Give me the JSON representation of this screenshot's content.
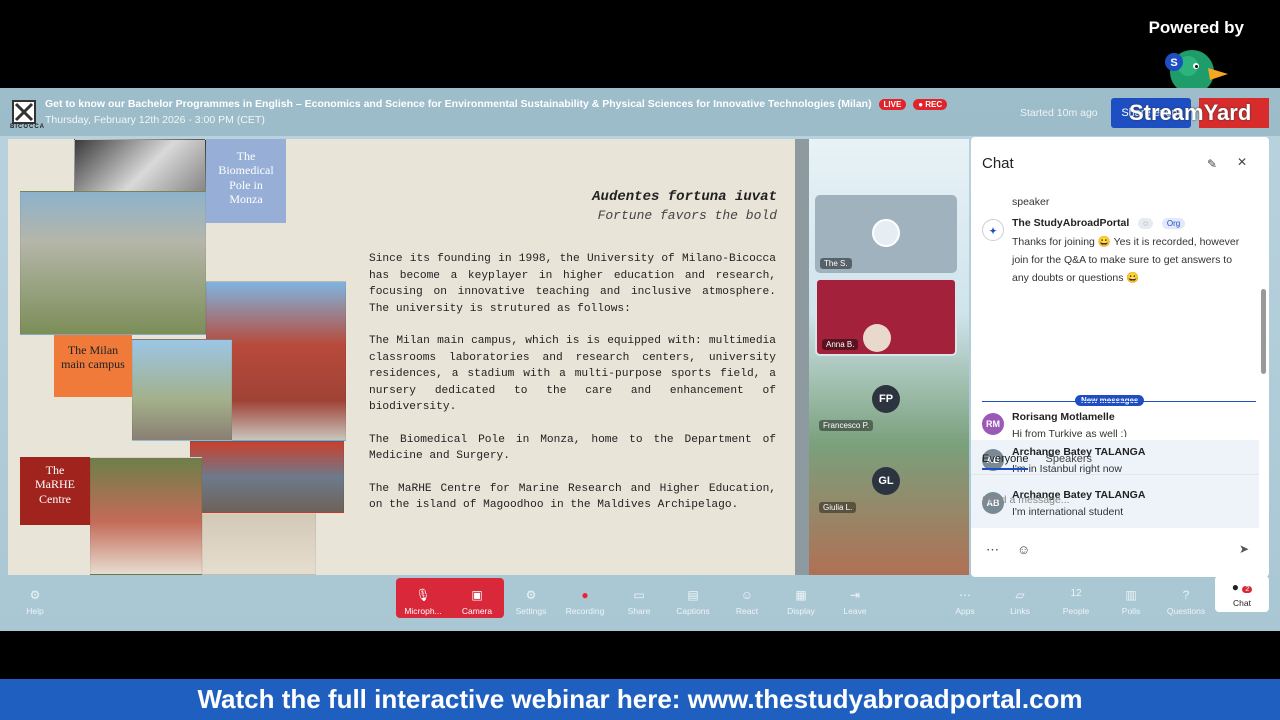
{
  "powered_by": "Powered by",
  "header": {
    "title": "Get to know our Bachelor Programmes in English – Economics and Science for Environmental Sustainability & Physical Sciences for Innovative Technologies (Milan)",
    "subtitle": "Thursday, February 12th 2026 - 3:00 PM (CET)",
    "live_badge": "LIVE",
    "rec_badge": "REC",
    "started": "Started 10m ago",
    "share_label": "Share event",
    "streamyard_text": "StreamYard"
  },
  "slide": {
    "motto_latin": "Audentes fortuna iuvat",
    "motto_english": "Fortune favors the bold",
    "paragraphs": [
      "Since its founding in 1998, the University of Milano-Bicocca has become a keyplayer in higher education and research, focusing on innovative teaching and inclusive atmosphere. The university is strutured as follows:",
      "The Milan main campus, which is is equipped with: multimedia classrooms laboratories and research centers, university residences, a stadium with a multi-purpose sports field, a nursery dedicated to the care and enhancement of biodiversity.",
      "The Biomedical Pole in Monza, home to the Department of Medicine and Surgery.",
      "The MaRHE Centre for Marine Research and Higher Education, on the island of Magoodhoo in the Maldives Archipelago."
    ],
    "note_biomedical": "The Biomedical Pole in Monza",
    "note_milan": "The Milan main campus",
    "note_marhe": "The MaRHE Centre"
  },
  "participants": {
    "tile1_label": "The S.",
    "tile2_label": "Anna B.",
    "fp_initials": "FP",
    "fp_label": "Francesco P.",
    "gl_initials": "GL",
    "gl_label": "Giulia L."
  },
  "chat": {
    "title": "Chat",
    "messages": [
      {
        "name": "",
        "text": "speaker"
      },
      {
        "name": "The StudyAbroadPortal",
        "tag": "Org",
        "text": "Thanks for joining 😀 Yes it is recorded, however join for the Q&A to make sure to get answers to any doubts or questions 😀"
      },
      {
        "initials": "RM",
        "name": "Rorisang Motlamelle",
        "text": "Hi from Turkiye as well :)"
      },
      {
        "initials": "AB",
        "name": "Archange Batey TALANGA",
        "text": "I'm in Istanbul right now"
      },
      {
        "initials": "AB",
        "name": "Archange Batey TALANGA",
        "text": "I'm international student"
      }
    ],
    "new_messages": "New messages",
    "tab_everyone": "Everyone",
    "tab_speakers": "Speakers",
    "input_placeholder": "Send a message..."
  },
  "toolbar": {
    "help": "Help",
    "microphone": "Microph...",
    "camera": "Camera",
    "settings": "Settings",
    "recording": "Recording",
    "share": "Share",
    "captions": "Captions",
    "react": "React",
    "display": "Display",
    "leave": "Leave",
    "apps": "Apps",
    "links": "Links",
    "people_count": "12",
    "people": "People",
    "polls": "Polls",
    "questions": "Questions",
    "chat": "Chat",
    "chat_badge": "2"
  },
  "banner": "Watch the full interactive webinar here: www.thestudyabroadportal.com",
  "colors": {
    "accent": "#1e4fc2",
    "red": "#d8283a",
    "banner": "#1f5fbf"
  }
}
